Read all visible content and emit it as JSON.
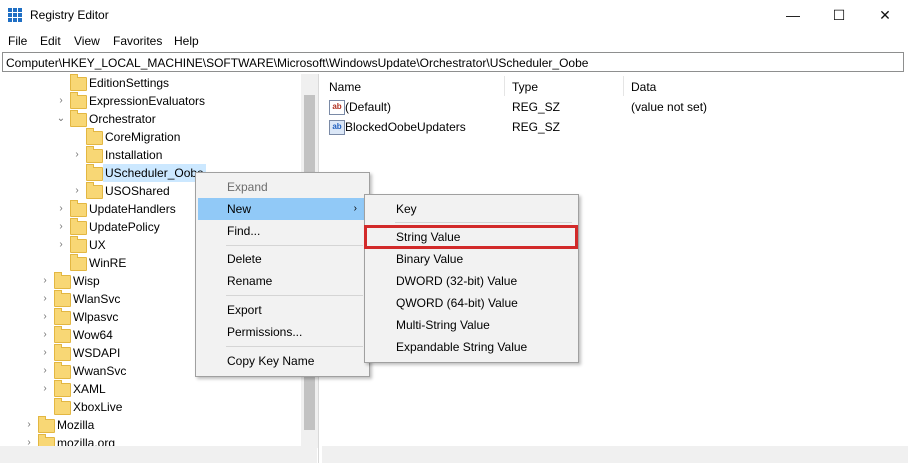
{
  "window": {
    "title": "Registry Editor",
    "minimize_glyph": "—",
    "maximize_glyph": "☐",
    "close_glyph": "✕"
  },
  "menubar": [
    "File",
    "Edit",
    "View",
    "Favorites",
    "Help"
  ],
  "address": "Computer\\HKEY_LOCAL_MACHINE\\SOFTWARE\\Microsoft\\WindowsUpdate\\Orchestrator\\UScheduler_Oobe",
  "tree": {
    "nodes": [
      {
        "label": "EditionSettings",
        "chevron": ""
      },
      {
        "label": "ExpressionEvaluators",
        "chevron": "›"
      },
      {
        "label": "Orchestrator",
        "chevron": "⌄"
      },
      {
        "label": "CoreMigration",
        "chevron": ""
      },
      {
        "label": "Installation",
        "chevron": "›"
      },
      {
        "label": "UScheduler_Oobe",
        "chevron": ""
      },
      {
        "label": "USOShared",
        "chevron": "›"
      },
      {
        "label": "UpdateHandlers",
        "chevron": "›"
      },
      {
        "label": "UpdatePolicy",
        "chevron": "›"
      },
      {
        "label": "UX",
        "chevron": "›"
      },
      {
        "label": "WinRE",
        "chevron": ""
      },
      {
        "label": "Wisp",
        "chevron": "›"
      },
      {
        "label": "WlanSvc",
        "chevron": "›"
      },
      {
        "label": "Wlpasvc",
        "chevron": "›"
      },
      {
        "label": "Wow64",
        "chevron": "›"
      },
      {
        "label": "WSDAPI",
        "chevron": "›"
      },
      {
        "label": "WwanSvc",
        "chevron": "›"
      },
      {
        "label": "XAML",
        "chevron": "›"
      },
      {
        "label": "XboxLive",
        "chevron": ""
      },
      {
        "label": "Mozilla",
        "chevron": "›"
      },
      {
        "label": "mozilla.org",
        "chevron": "›"
      }
    ]
  },
  "values_table": {
    "columns": [
      "Name",
      "Type",
      "Data"
    ],
    "rows": [
      {
        "icon": "string-value-icon",
        "icon_text": "ab",
        "name": "(Default)",
        "type": "REG_SZ",
        "data": "(value not set)"
      },
      {
        "icon": "string-value-icon",
        "icon_text": "ab",
        "name": "BlockedOobeUpdaters",
        "type": "REG_SZ",
        "data": ""
      }
    ]
  },
  "context_menu": {
    "items": [
      "Expand",
      "New",
      "Find...",
      "Delete",
      "Rename",
      "Export",
      "Permissions...",
      "Copy Key Name"
    ],
    "submenu_arrow": "›"
  },
  "new_submenu": {
    "items": [
      "Key",
      "String Value",
      "Binary Value",
      "DWORD (32-bit) Value",
      "QWORD (64-bit) Value",
      "Multi-String Value",
      "Expandable String Value"
    ]
  },
  "colors": {
    "highlight": "#91c9f7",
    "selection": "#cce8ff",
    "callout_border": "#d22a2a",
    "folder": "#f8d775"
  }
}
